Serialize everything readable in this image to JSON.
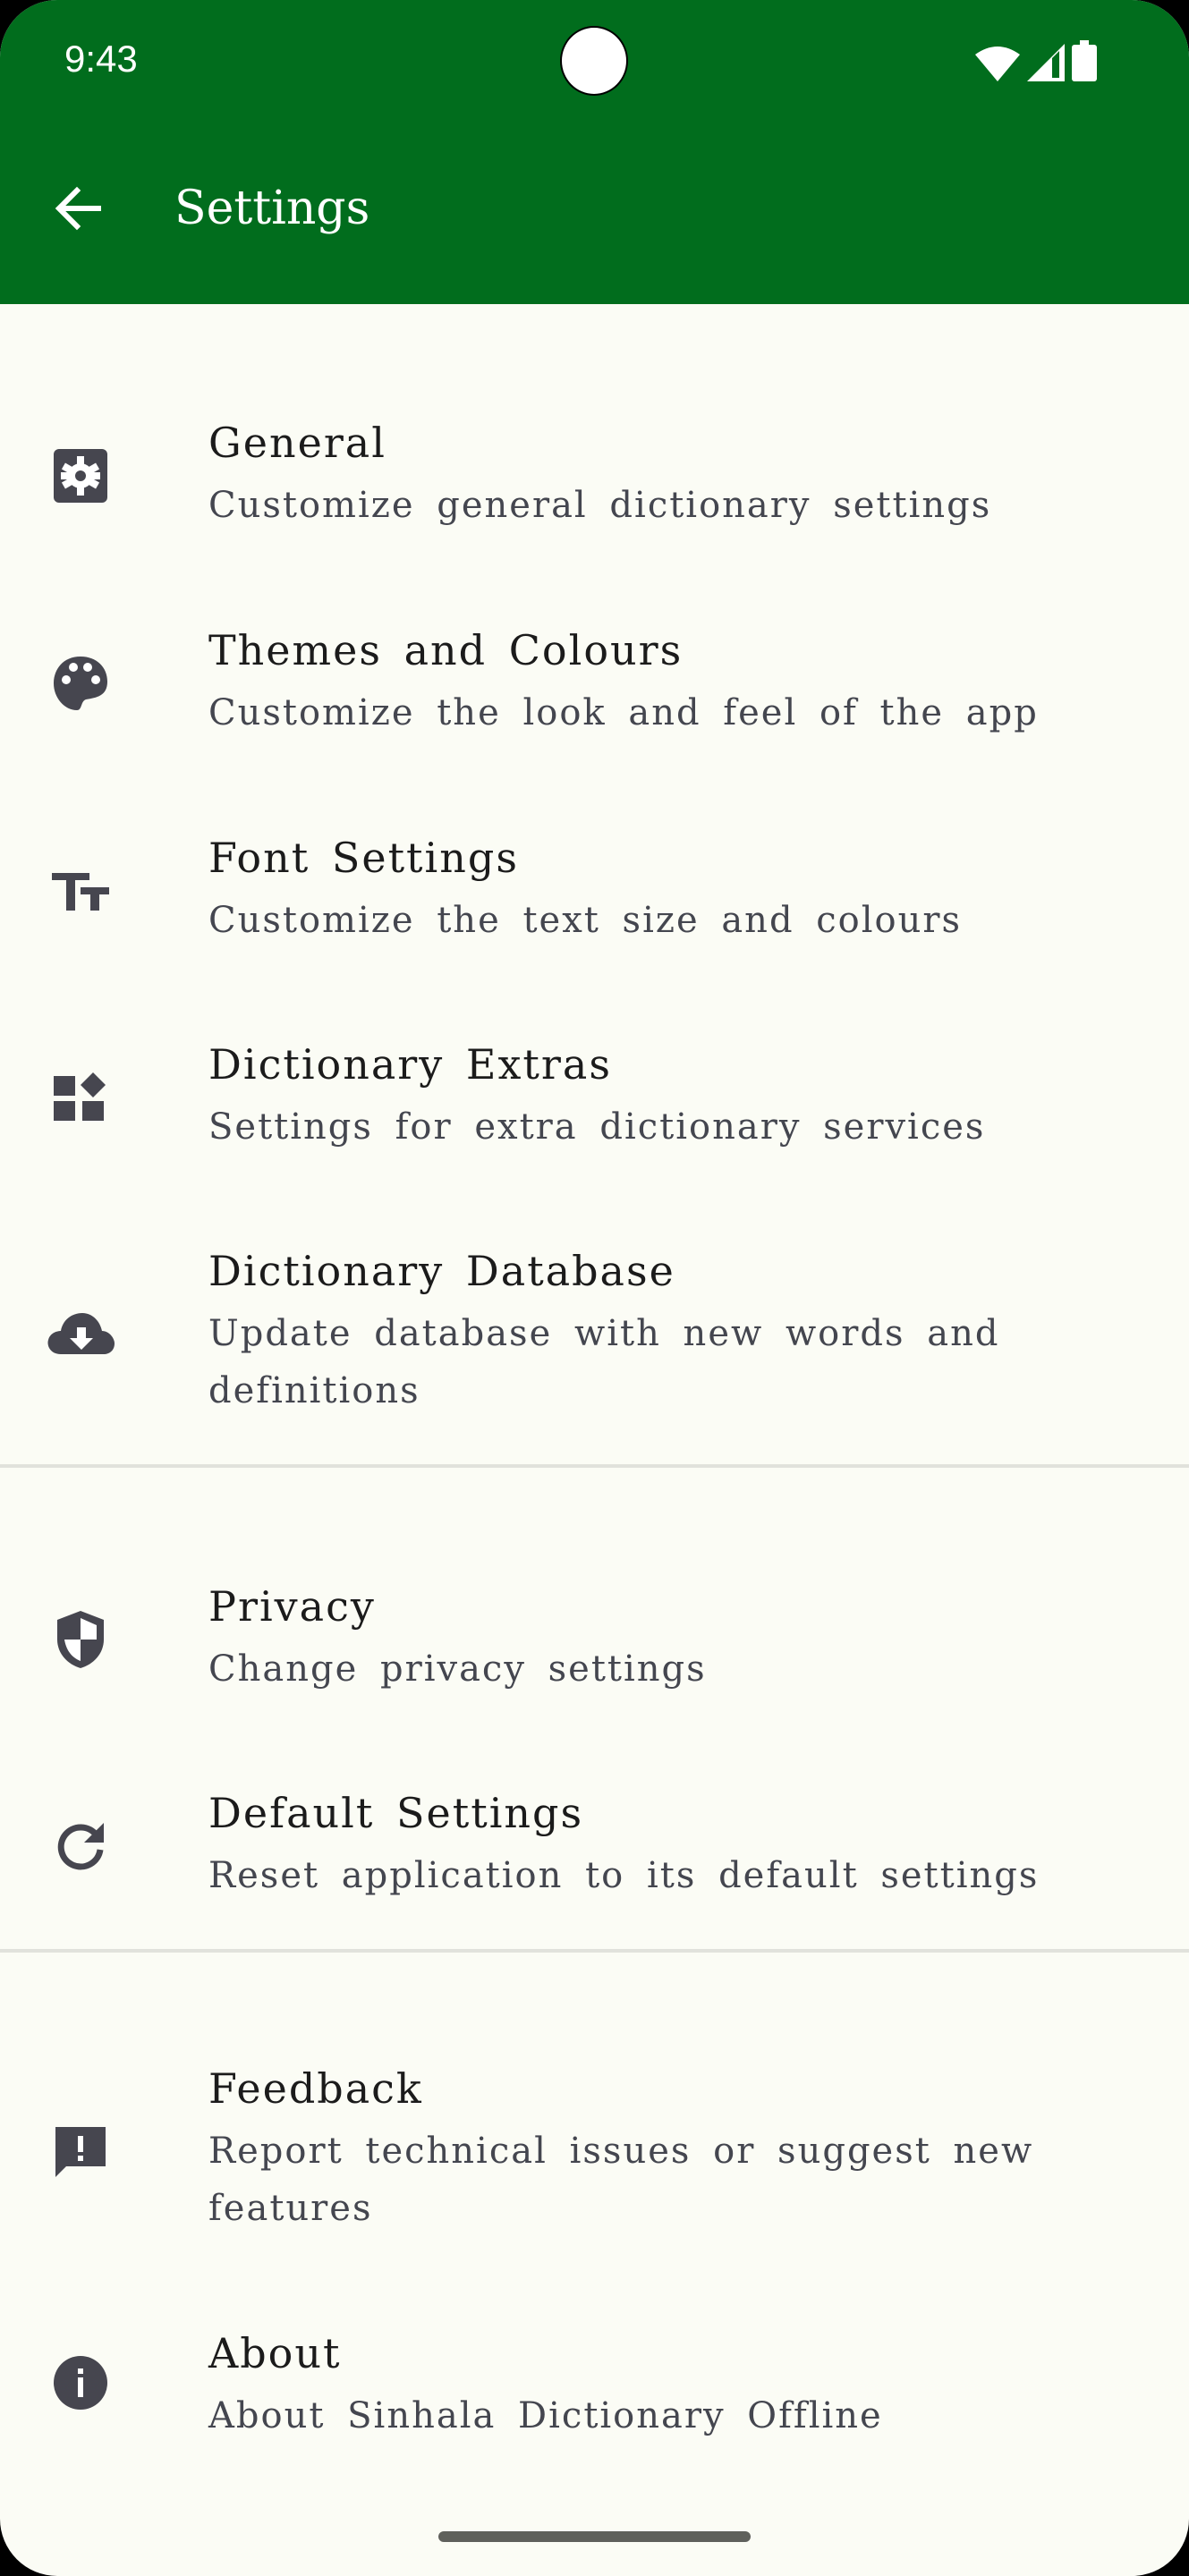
{
  "status_bar": {
    "time": "9:43",
    "icons": [
      "wifi-icon",
      "signal-icon",
      "battery-icon"
    ]
  },
  "app_bar": {
    "title": "Settings",
    "back_icon": "arrow-back-icon",
    "color": "#016d1d"
  },
  "settings": [
    {
      "id": "general",
      "icon": "gear-icon",
      "title": "General",
      "subtitle": "Customize general dictionary settings"
    },
    {
      "id": "themes",
      "icon": "palette-icon",
      "title": "Themes and Colours",
      "subtitle": "Customize the look and feel of the app"
    },
    {
      "id": "font",
      "icon": "text-size-icon",
      "title": "Font Settings",
      "subtitle": "Customize the text size and colours"
    },
    {
      "id": "extras",
      "icon": "widgets-icon",
      "title": "Dictionary Extras",
      "subtitle": "Settings for extra dictionary services"
    },
    {
      "id": "database",
      "icon": "cloud-download-icon",
      "title": "Dictionary Database",
      "subtitle": "Update database with new words and definitions"
    },
    {
      "id": "privacy",
      "icon": "shield-icon",
      "title": "Privacy",
      "subtitle": "Change privacy settings"
    },
    {
      "id": "default",
      "icon": "refresh-icon",
      "title": "Default Settings",
      "subtitle": "Reset application to its default settings"
    },
    {
      "id": "feedback",
      "icon": "feedback-icon",
      "title": "Feedback",
      "subtitle": "Report technical issues or suggest new features"
    },
    {
      "id": "about",
      "icon": "info-icon",
      "title": "About",
      "subtitle": "About Sinhala Dictionary Offline"
    }
  ]
}
